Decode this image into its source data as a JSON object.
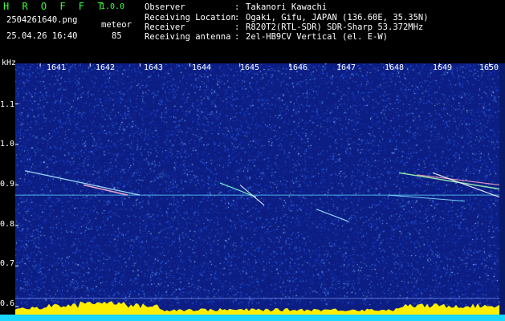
{
  "header": {
    "title": "H R O F F T",
    "version": "1.0.0",
    "filename": "2504261640.png",
    "datetime": "25.04.26 16:40",
    "meteor_label": "meteor",
    "meteor_count": "85"
  },
  "info": [
    {
      "key": "Observer",
      "value": "Takanori Kawachi"
    },
    {
      "key": "Receiving Location",
      "value": "Ogaki, Gifu, JAPAN (136.60E, 35.35N)"
    },
    {
      "key": "Receiver",
      "value": "R820T2(RTL-SDR) SDR-Sharp 53.372MHz"
    },
    {
      "key": "Receiving antenna",
      "value": "2el-HB9CV Vertical (el. E-W)"
    }
  ],
  "info_sep": ":",
  "chart_data": {
    "type": "heatmap",
    "ylabel": "kHz",
    "y_ticks": [
      "1.1",
      "1.0",
      "0.9",
      "0.8",
      "0.7",
      "0.6"
    ],
    "y_values": [
      1.1,
      1.0,
      0.9,
      0.8,
      0.7,
      0.6
    ],
    "x_ticks": [
      "1641",
      "1642",
      "1643",
      "1644",
      "1645",
      "1646",
      "1647",
      "1648",
      "1649",
      "1650"
    ],
    "ylim": [
      0.58,
      1.2
    ],
    "xlim": [
      1640.5,
      1650.2
    ],
    "carrier_khz": 0.875,
    "colors": {
      "background": "#0c1e84",
      "noise_low": "#1b3fc8",
      "noise_mid": "#3a7bff",
      "noise_high": "#9fd7ff",
      "trail": "#ffffff",
      "level": "#ffee00",
      "baseline": "#19d7ff"
    }
  }
}
